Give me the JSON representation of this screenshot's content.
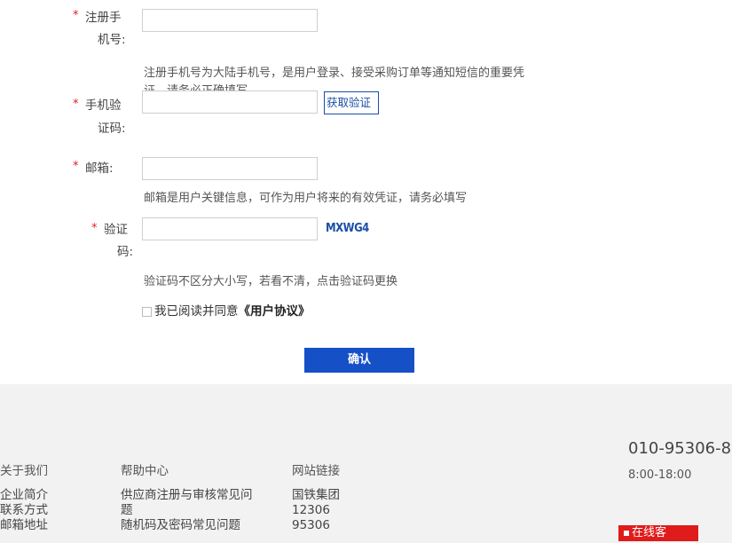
{
  "form": {
    "phone": {
      "required_mark": "*",
      "label_line1": "注册手",
      "label_line2": "机号:",
      "hint_line1": "注册手机号为大陆手机号，是用户登录、接受采购订单等通知短信的重要凭",
      "hint_line2": "证，请务必正确填写"
    },
    "sms_code": {
      "required_mark": "*",
      "label_line1": "手机验",
      "label_line2": "证码:",
      "button_label": "获取验证"
    },
    "email": {
      "required_mark": "*",
      "label": "邮箱:",
      "hint": "邮箱是用户关键信息，可作为用户将来的有效凭证，请务必填写"
    },
    "captcha": {
      "required_mark": "*",
      "label_line1": "验证",
      "label_line2": "码:",
      "image_text": "MXWG4",
      "hint": "验证码不区分大小写，若看不清，点击验证码更换"
    },
    "agreement": {
      "prefix": "我已阅读并同意",
      "link": "《用户协议》"
    },
    "submit_label": "确认"
  },
  "footer": {
    "about": {
      "heading": "关于我们",
      "links": [
        "企业简介",
        "联系方式",
        "邮箱地址"
      ]
    },
    "help": {
      "heading": "帮助中心",
      "link1_line1": "供应商注册与审核常见问",
      "link1_line2": "题",
      "link2": "随机码及密码常见问题"
    },
    "sites": {
      "heading": "网站链接",
      "links": [
        "国铁集团",
        "12306",
        "95306"
      ]
    },
    "phone": "010-95306-8",
    "hours": "8:00-18:00",
    "online_service": "在线客"
  },
  "colors": {
    "required": "#e02020",
    "brand_blue": "#1650c6",
    "online_red": "#e01b1b",
    "footer_bg": "#f2f2f2"
  }
}
